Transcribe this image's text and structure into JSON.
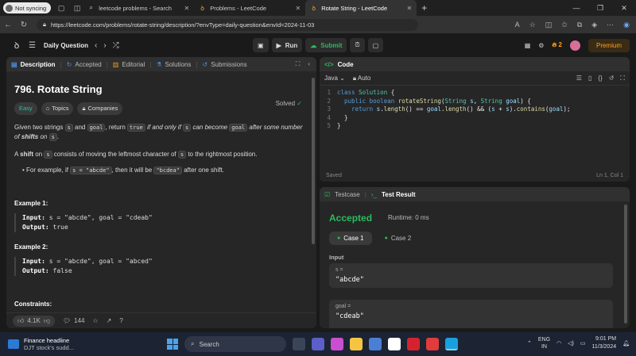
{
  "browser": {
    "profile_label": "Not syncing",
    "tabs": [
      {
        "title": "leetcode problems - Search",
        "icon": "search-icon"
      },
      {
        "title": "Problems - LeetCode",
        "icon": "leetcode-icon"
      },
      {
        "title": "Rotate String - LeetCode",
        "icon": "leetcode-icon",
        "active": true
      }
    ],
    "url": "https://leetcode.com/problems/rotate-string/description/?envType=daily-question&envId=2024-11-03"
  },
  "lc_header": {
    "daily_label": "Daily Question",
    "run_label": "Run",
    "submit_label": "Submit",
    "streak": "2",
    "premium_label": "Premium"
  },
  "left_tabs": [
    "Description",
    "Accepted",
    "Editorial",
    "Solutions",
    "Submissions"
  ],
  "problem": {
    "title": "796. Rotate String",
    "solved_label": "Solved",
    "tags": [
      "Easy",
      "Topics",
      "Companies"
    ],
    "p1_a": "Given two strings ",
    "p1_s": "s",
    "p1_b": " and ",
    "p1_goal": "goal",
    "p1_c": ", return ",
    "p1_true": "true",
    "p1_d": " if and only if ",
    "p1_s2": "s",
    "p1_e": " can become ",
    "p1_goal2": "goal",
    "p1_f": " after some number of ",
    "p1_shifts": "shifts",
    "p1_g": " on ",
    "p1_s3": "s",
    "p1_h": ".",
    "p2_a": "A ",
    "p2_shift": "shift",
    "p2_b": " on ",
    "p2_s": "s",
    "p2_c": " consists of moving the leftmost character of ",
    "p2_s2": "s",
    "p2_d": " to the rightmost position.",
    "bullet_a": "For example, if ",
    "bullet_code1": "s = \"abcde\"",
    "bullet_b": ", then it will be ",
    "bullet_code2": "\"bcdea\"",
    "bullet_c": " after one shift.",
    "examples": [
      {
        "title": "Example 1:",
        "input": "s = \"abcde\", goal = \"cdeab\"",
        "output": "true"
      },
      {
        "title": "Example 2:",
        "input": "s = \"abcde\", goal = \"abced\"",
        "output": "false"
      }
    ],
    "input_label": "Input:",
    "output_label": "Output:",
    "constraints_label": "Constraints:"
  },
  "footer_stats": {
    "likes": "4.1K",
    "comments": "144"
  },
  "code_panel": {
    "title": "Code",
    "language": "Java",
    "mode": "Auto",
    "lines": [
      "class Solution {",
      "    public boolean rotateString(String s, String goal) {",
      "        return s.length() == goal.length() && (s + s).contains(goal);",
      "    }",
      "}"
    ],
    "saved_label": "Saved",
    "cursor_pos": "Ln 1, Col 1"
  },
  "result_panel": {
    "testcase_tab": "Testcase",
    "result_tab": "Test Result",
    "status": "Accepted",
    "runtime": "Runtime: 0 ms",
    "cases": [
      "Case 1",
      "Case 2"
    ],
    "input_label": "Input",
    "fields": [
      {
        "name": "s =",
        "value": "\"abcde\""
      },
      {
        "name": "goal =",
        "value": "\"cdeab\""
      }
    ]
  },
  "taskbar": {
    "news_title": "Finance headline",
    "news_sub": "DJT stock's sudd...",
    "search_label": "Search",
    "lang1": "ENG",
    "lang2": "IN",
    "time": "9:01 PM",
    "date": "11/3/2024"
  }
}
